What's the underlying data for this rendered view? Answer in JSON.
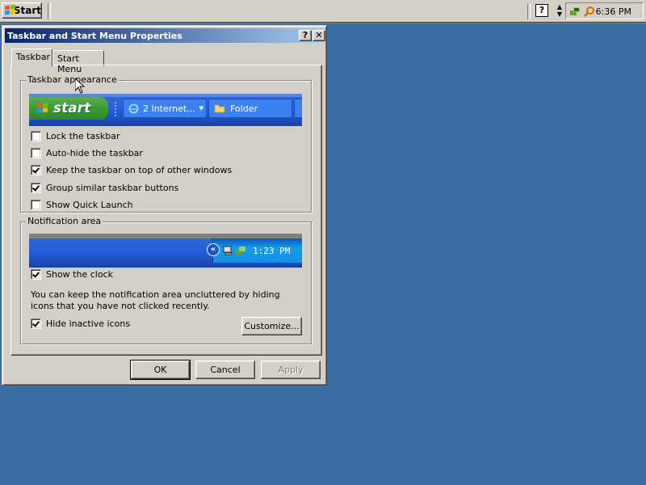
{
  "taskbar": {
    "start_label": "Start",
    "help_icon_glyph": "?",
    "clock": "6:36 PM"
  },
  "dialog": {
    "title": "Taskbar and Start Menu Properties",
    "help_button": "?",
    "close_button": "✕",
    "tabs": [
      {
        "label": "Taskbar",
        "active": true
      },
      {
        "label": "Start Menu",
        "active": false
      }
    ],
    "appearance": {
      "title": "Taskbar appearance",
      "preview": {
        "start_label": "start",
        "buttons": [
          "2 Internet...",
          "Folder"
        ]
      },
      "options": [
        {
          "label": "Lock the taskbar",
          "checked": false
        },
        {
          "label": "Auto-hide the taskbar",
          "checked": false
        },
        {
          "label": "Keep the taskbar on top of other windows",
          "checked": true
        },
        {
          "label": "Group similar taskbar buttons",
          "checked": true
        },
        {
          "label": "Show Quick Launch",
          "checked": false
        }
      ]
    },
    "notification": {
      "title": "Notification area",
      "preview_time": "1:23 PM",
      "show_clock": {
        "label": "Show the clock",
        "checked": true
      },
      "description": "You can keep the notification area uncluttered by hiding icons that you have not clicked recently.",
      "hide_inactive": {
        "label": "Hide inactive icons",
        "checked": true
      },
      "customize_label": "Customize..."
    },
    "buttons": {
      "ok": "OK",
      "cancel": "Cancel",
      "apply": "Apply"
    }
  },
  "colors": {
    "desktop": "#3a6ea5",
    "dialog_face": "#d4d0c8",
    "title_start": "#0a246a",
    "title_end": "#a6caf0"
  }
}
